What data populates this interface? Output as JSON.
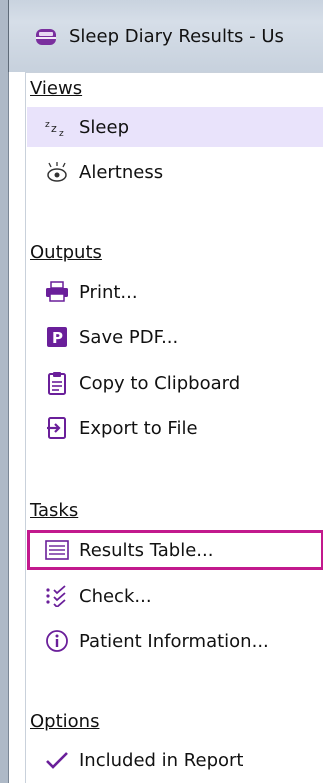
{
  "window": {
    "title": "Sleep Diary Results - Us"
  },
  "sections": {
    "views": {
      "heading": "Views",
      "items": [
        {
          "label": "Sleep",
          "icon": "sleep-zzz-icon"
        },
        {
          "label": "Alertness",
          "icon": "eye-alert-icon"
        }
      ]
    },
    "outputs": {
      "heading": "Outputs",
      "items": [
        {
          "label": "Print...",
          "icon": "printer-icon"
        },
        {
          "label": "Save PDF...",
          "icon": "pdf-icon"
        },
        {
          "label": "Copy to Clipboard",
          "icon": "clipboard-icon"
        },
        {
          "label": "Export to File",
          "icon": "export-icon"
        }
      ]
    },
    "tasks": {
      "heading": "Tasks",
      "items": [
        {
          "label": "Results Table...",
          "icon": "table-icon"
        },
        {
          "label": "Check...",
          "icon": "check-list-icon"
        },
        {
          "label": "Patient Information...",
          "icon": "info-icon"
        }
      ]
    },
    "options": {
      "heading": "Options",
      "items": [
        {
          "label": "Included in Report",
          "icon": "checkmark-icon"
        }
      ]
    }
  },
  "colors": {
    "selected_bg": "#e9e3fb",
    "highlight_border": "#c2198d",
    "accent_purple": "#6a1f9a"
  }
}
